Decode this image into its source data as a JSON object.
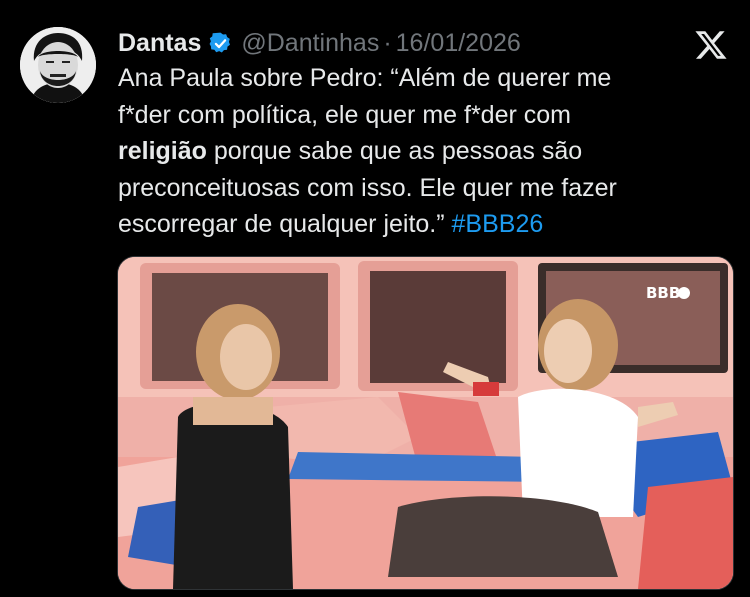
{
  "tweet": {
    "author_name": "Dantas",
    "author_handle": "@Dantinhas",
    "separator": "·",
    "date": "16/01/2026",
    "text_lines": [
      "Ana Paula sobre Pedro: “Além de querer me",
      "f*der com política, ele quer me f*der com",
      " porque sabe que as pessoas são",
      "preconceituosas com isso. Ele quer me fazer",
      "escorregar de qualquer jeito.” "
    ],
    "bold_word": "religião",
    "hashtag": "#BBB26",
    "media": {
      "watermark": "BBB"
    }
  },
  "icons": {
    "verified": "verified-badge-icon",
    "brand": "x-logo-icon"
  },
  "colors": {
    "background": "#000000",
    "text": "#e7e9ea",
    "muted": "#71767b",
    "accent": "#1d9bf0"
  }
}
